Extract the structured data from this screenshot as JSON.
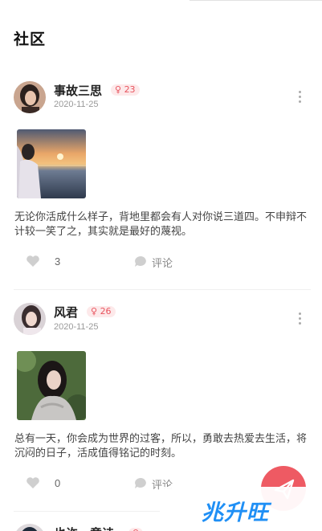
{
  "page": {
    "title": "社区"
  },
  "posts": [
    {
      "username": "事故三思",
      "gender_symbol": "♀",
      "age": "23",
      "date": "2020-11-25",
      "content": "无论你活成什么样子，背地里都会有人对你说三道四。不申辩不计较一笑了之，其实就是最好的蔑视。",
      "likes": "3",
      "comment_label": "评论"
    },
    {
      "username": "风君",
      "gender_symbol": "♀",
      "age": "26",
      "date": "2020-11-25",
      "content": "总有一天，你会成为世界的过客，所以，勇敢去热爱去生活，将沉闷的日子，活成值得铭记的时刻。",
      "likes": "0",
      "comment_label": "评论"
    },
    {
      "username": "也许一意诗",
      "gender_symbol": "♀",
      "age": ""
    }
  ],
  "watermark": {
    "text": "兆升旺"
  },
  "colors": {
    "accent": "#ee5a63",
    "badge_bg": "#fde9ea",
    "badge_text": "#e8545e"
  }
}
